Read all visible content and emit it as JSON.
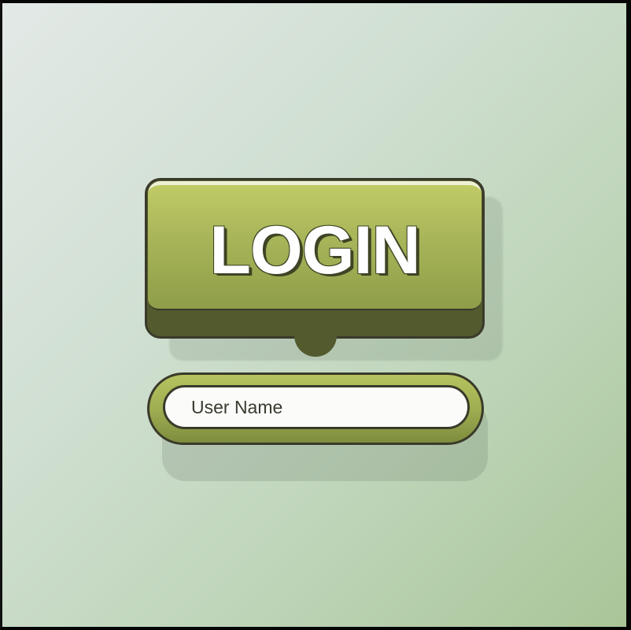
{
  "login": {
    "label": "LOGIN"
  },
  "username": {
    "placeholder": "User Name",
    "value": ""
  },
  "colors": {
    "button_green": "#aab65a",
    "button_dark": "#525a2e",
    "outline": "#3a3a2a",
    "background_start": "#e3e9e7",
    "background_end": "#a9c598"
  }
}
